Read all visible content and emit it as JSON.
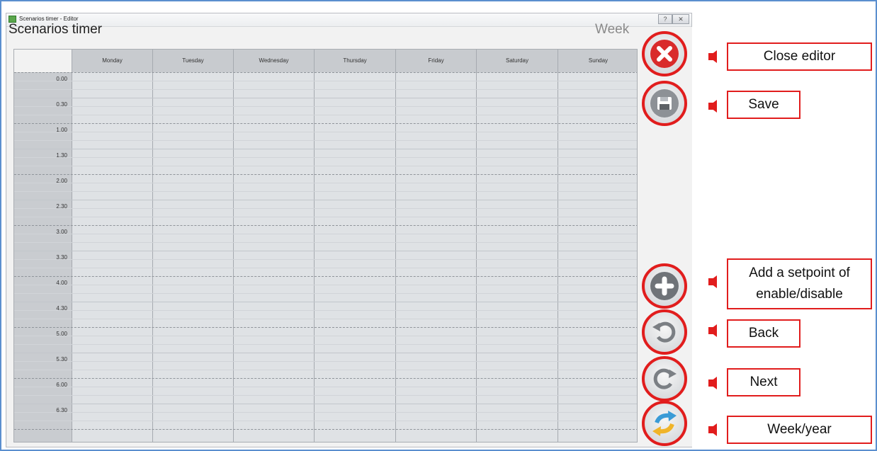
{
  "window": {
    "title": "Scenarios timer - Editor",
    "help_glyph": "?",
    "close_glyph": "✕"
  },
  "header": {
    "title": "Scenarios timer",
    "view_mode": "Week"
  },
  "grid": {
    "days": [
      "Monday",
      "Tuesday",
      "Wednesday",
      "Thursday",
      "Friday",
      "Saturday",
      "Sunday"
    ],
    "times": [
      "0.00",
      "0.30",
      "1.00",
      "1.30",
      "2.00",
      "2.30",
      "3.00",
      "3.30",
      "4.00",
      "4.30",
      "5.00",
      "5.30",
      "6.00",
      "6.30"
    ]
  },
  "side_buttons": [
    {
      "name": "close-editor-button",
      "icon": "close-x-icon"
    },
    {
      "name": "save-button",
      "icon": "floppy-disk-icon"
    },
    {
      "name": "add-setpoint-button",
      "icon": "plus-icon"
    },
    {
      "name": "back-button",
      "icon": "undo-arrow-icon"
    },
    {
      "name": "next-button",
      "icon": "redo-arrow-icon"
    },
    {
      "name": "week-year-button",
      "icon": "swap-arrows-icon"
    }
  ],
  "annotations": {
    "close_editor": "Close editor",
    "save": "Save",
    "add_setpoint_line1": "Add a setpoint of",
    "add_setpoint_line2": "enable/disable",
    "back": "Back",
    "next": "Next",
    "week_year": "Week/year"
  },
  "colors": {
    "annotation_red": "#e11d1d",
    "close_button_red": "#d92b2b",
    "swap_blue": "#3a9bd6",
    "swap_yellow": "#f0b429"
  }
}
